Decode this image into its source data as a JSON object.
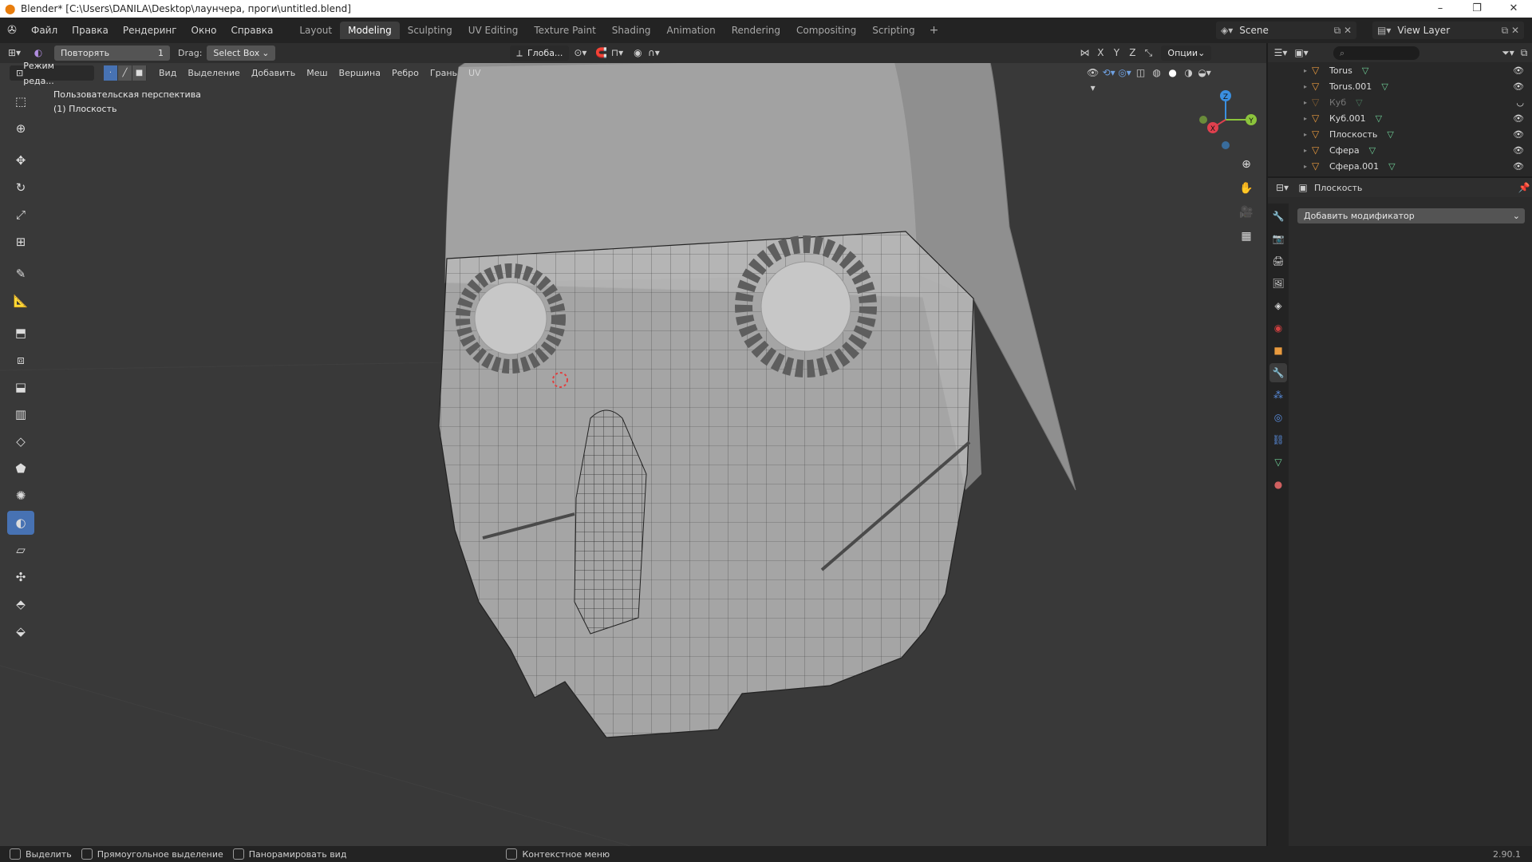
{
  "window": {
    "title": "Blender* [C:\\Users\\DANILA\\Desktop\\лаунчера, проги\\untitled.blend]",
    "controls": [
      "–",
      "❐",
      "✕"
    ]
  },
  "menubar": {
    "items": [
      "Файл",
      "Правка",
      "Рендеринг",
      "Окно",
      "Справка"
    ],
    "workspace_tabs": [
      "Layout",
      "Modeling",
      "Sculpting",
      "UV Editing",
      "Texture Paint",
      "Shading",
      "Animation",
      "Rendering",
      "Compositing",
      "Scripting"
    ],
    "active_tab": "Modeling",
    "add_tab": "+",
    "scene": "Scene",
    "view_layer": "View Layer"
  },
  "viewport_header": {
    "repeat_label": "Повторять",
    "repeat_count": "1",
    "drag_label": "Drag:",
    "drag_value": "Select Box",
    "transform_orientation": "Глоба...",
    "options_label": "Опции",
    "axes": [
      "X",
      "Y",
      "Z"
    ]
  },
  "viewport_header2": {
    "mode": "Режим реда...",
    "menus": [
      "Вид",
      "Выделение",
      "Добавить",
      "Меш",
      "Вершина",
      "Ребро",
      "Грань",
      "UV"
    ]
  },
  "viewport_info": {
    "line1": "Пользовательская перспектива",
    "line2": "(1) Плоскость"
  },
  "gizmo": {
    "x": "X",
    "y": "Y",
    "z": "Z"
  },
  "toolbar": {
    "tools": [
      "select-box",
      "cursor",
      "move",
      "rotate",
      "scale",
      "transform",
      "annotate",
      "measure",
      "extrude-region",
      "inset-faces",
      "bevel",
      "loop-cut",
      "knife",
      "poly-build",
      "spin",
      "smooth",
      "edge-slide",
      "shrink-fatten",
      "shear",
      "rip-region"
    ],
    "active": "smooth"
  },
  "outliner": {
    "items": [
      {
        "name": "Torus",
        "visible": true
      },
      {
        "name": "Torus.001",
        "visible": true
      },
      {
        "name": "Куб",
        "visible": false
      },
      {
        "name": "Куб.001",
        "visible": true
      },
      {
        "name": "Плоскость",
        "visible": true
      },
      {
        "name": "Сфера",
        "visible": true
      },
      {
        "name": "Сфера.001",
        "visible": true
      }
    ]
  },
  "properties": {
    "object_name": "Плоскость",
    "add_modifier": "Добавить модификатор",
    "tabs": [
      "tool",
      "render",
      "output",
      "view-layer",
      "scene",
      "world",
      "object",
      "modifiers",
      "particles",
      "physics",
      "constraints",
      "data",
      "material"
    ],
    "active_tab": "modifiers"
  },
  "statusbar": {
    "select": "Выделить",
    "box_select": "Прямоугольное выделение",
    "pan_view": "Панорамировать вид",
    "context_menu": "Контекстное меню",
    "version": "2.90.1"
  },
  "colors": {
    "accent": "#4772b3",
    "object_orange": "#e99a3e",
    "mesh_green": "#6fcf97",
    "axis_x": "#e0404e",
    "axis_y": "#8cc43c",
    "axis_z": "#3a8fe0"
  }
}
